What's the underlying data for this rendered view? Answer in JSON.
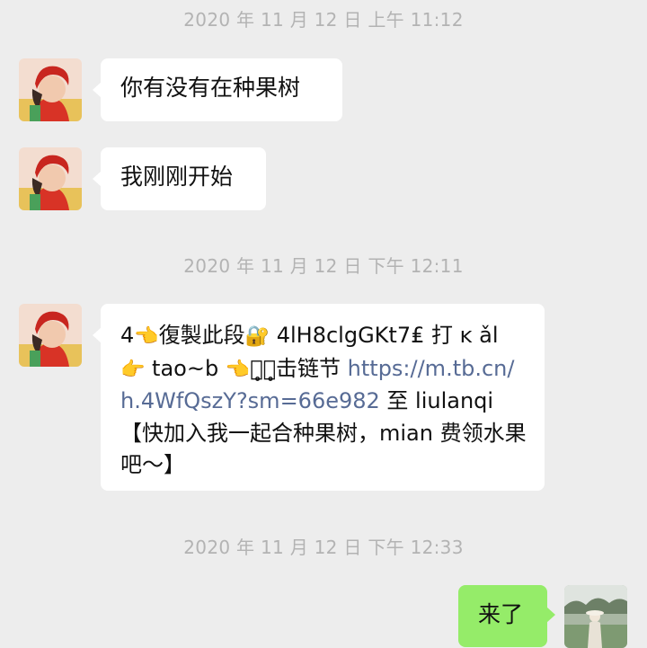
{
  "messages": [
    {
      "type": "time",
      "text": "2020 年 11 月 12 日 上午 11:12"
    },
    {
      "type": "text",
      "side": "left",
      "text": "你有没有在种果树"
    },
    {
      "type": "text",
      "side": "left",
      "text": "我刚刚开始"
    },
    {
      "type": "time",
      "text": "2020 年 11 月 12 日 下午 12:11"
    },
    {
      "type": "share",
      "side": "left",
      "parts": {
        "p1": "4",
        "emoji_point1": "👈",
        "p2": "復製此段",
        "emoji_lock": "🔐",
        "p3": " 4lH8clgGKt7₤ 打 ĸ ǎl ",
        "emoji_point2": "👉",
        "p4": " tao~b ",
        "emoji_point3": "👈",
        "p5": "或̥點̥击链节 ",
        "link": "https://m.tb.cn/h.4WfQszY?sm=66e982",
        "p6": " 至 liulanqi【快加入我一起合种果树，mian 费领水果吧～】"
      }
    },
    {
      "type": "time",
      "text": "2020 年 11 月 12 日 下午 12:33"
    },
    {
      "type": "text",
      "side": "right",
      "text": "来了"
    }
  ],
  "colors": {
    "background": "#ededed",
    "bubble_incoming": "#ffffff",
    "bubble_outgoing": "#95ec69",
    "timestamp": "#b3b3b3",
    "link": "#576b95"
  },
  "icons": {
    "avatar_contact": "contact-avatar",
    "avatar_self": "self-avatar"
  }
}
